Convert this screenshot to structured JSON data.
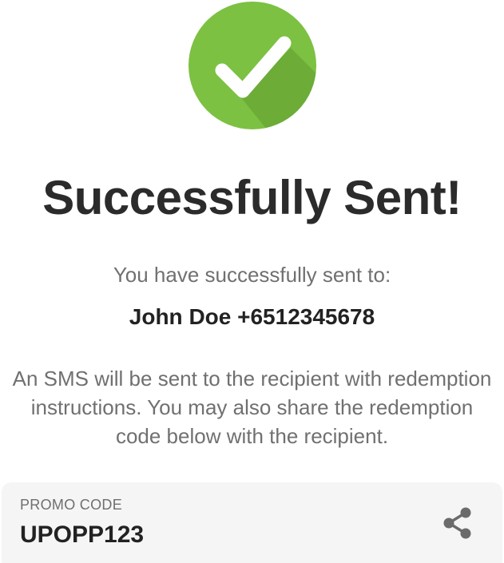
{
  "success": {
    "icon": "check-circle-icon",
    "icon_color": "#7cc142",
    "title": "Successfully Sent!"
  },
  "recipient_block": {
    "label": "You have successfully sent to:",
    "recipient": "John Doe +6512345678"
  },
  "info": {
    "text": "An SMS will be sent to the recipient with redemption instructions. You may also share the redemption code below with the recipient."
  },
  "promo": {
    "label": "PROMO CODE",
    "code": "UPOPP123",
    "share_icon": "share-icon"
  }
}
